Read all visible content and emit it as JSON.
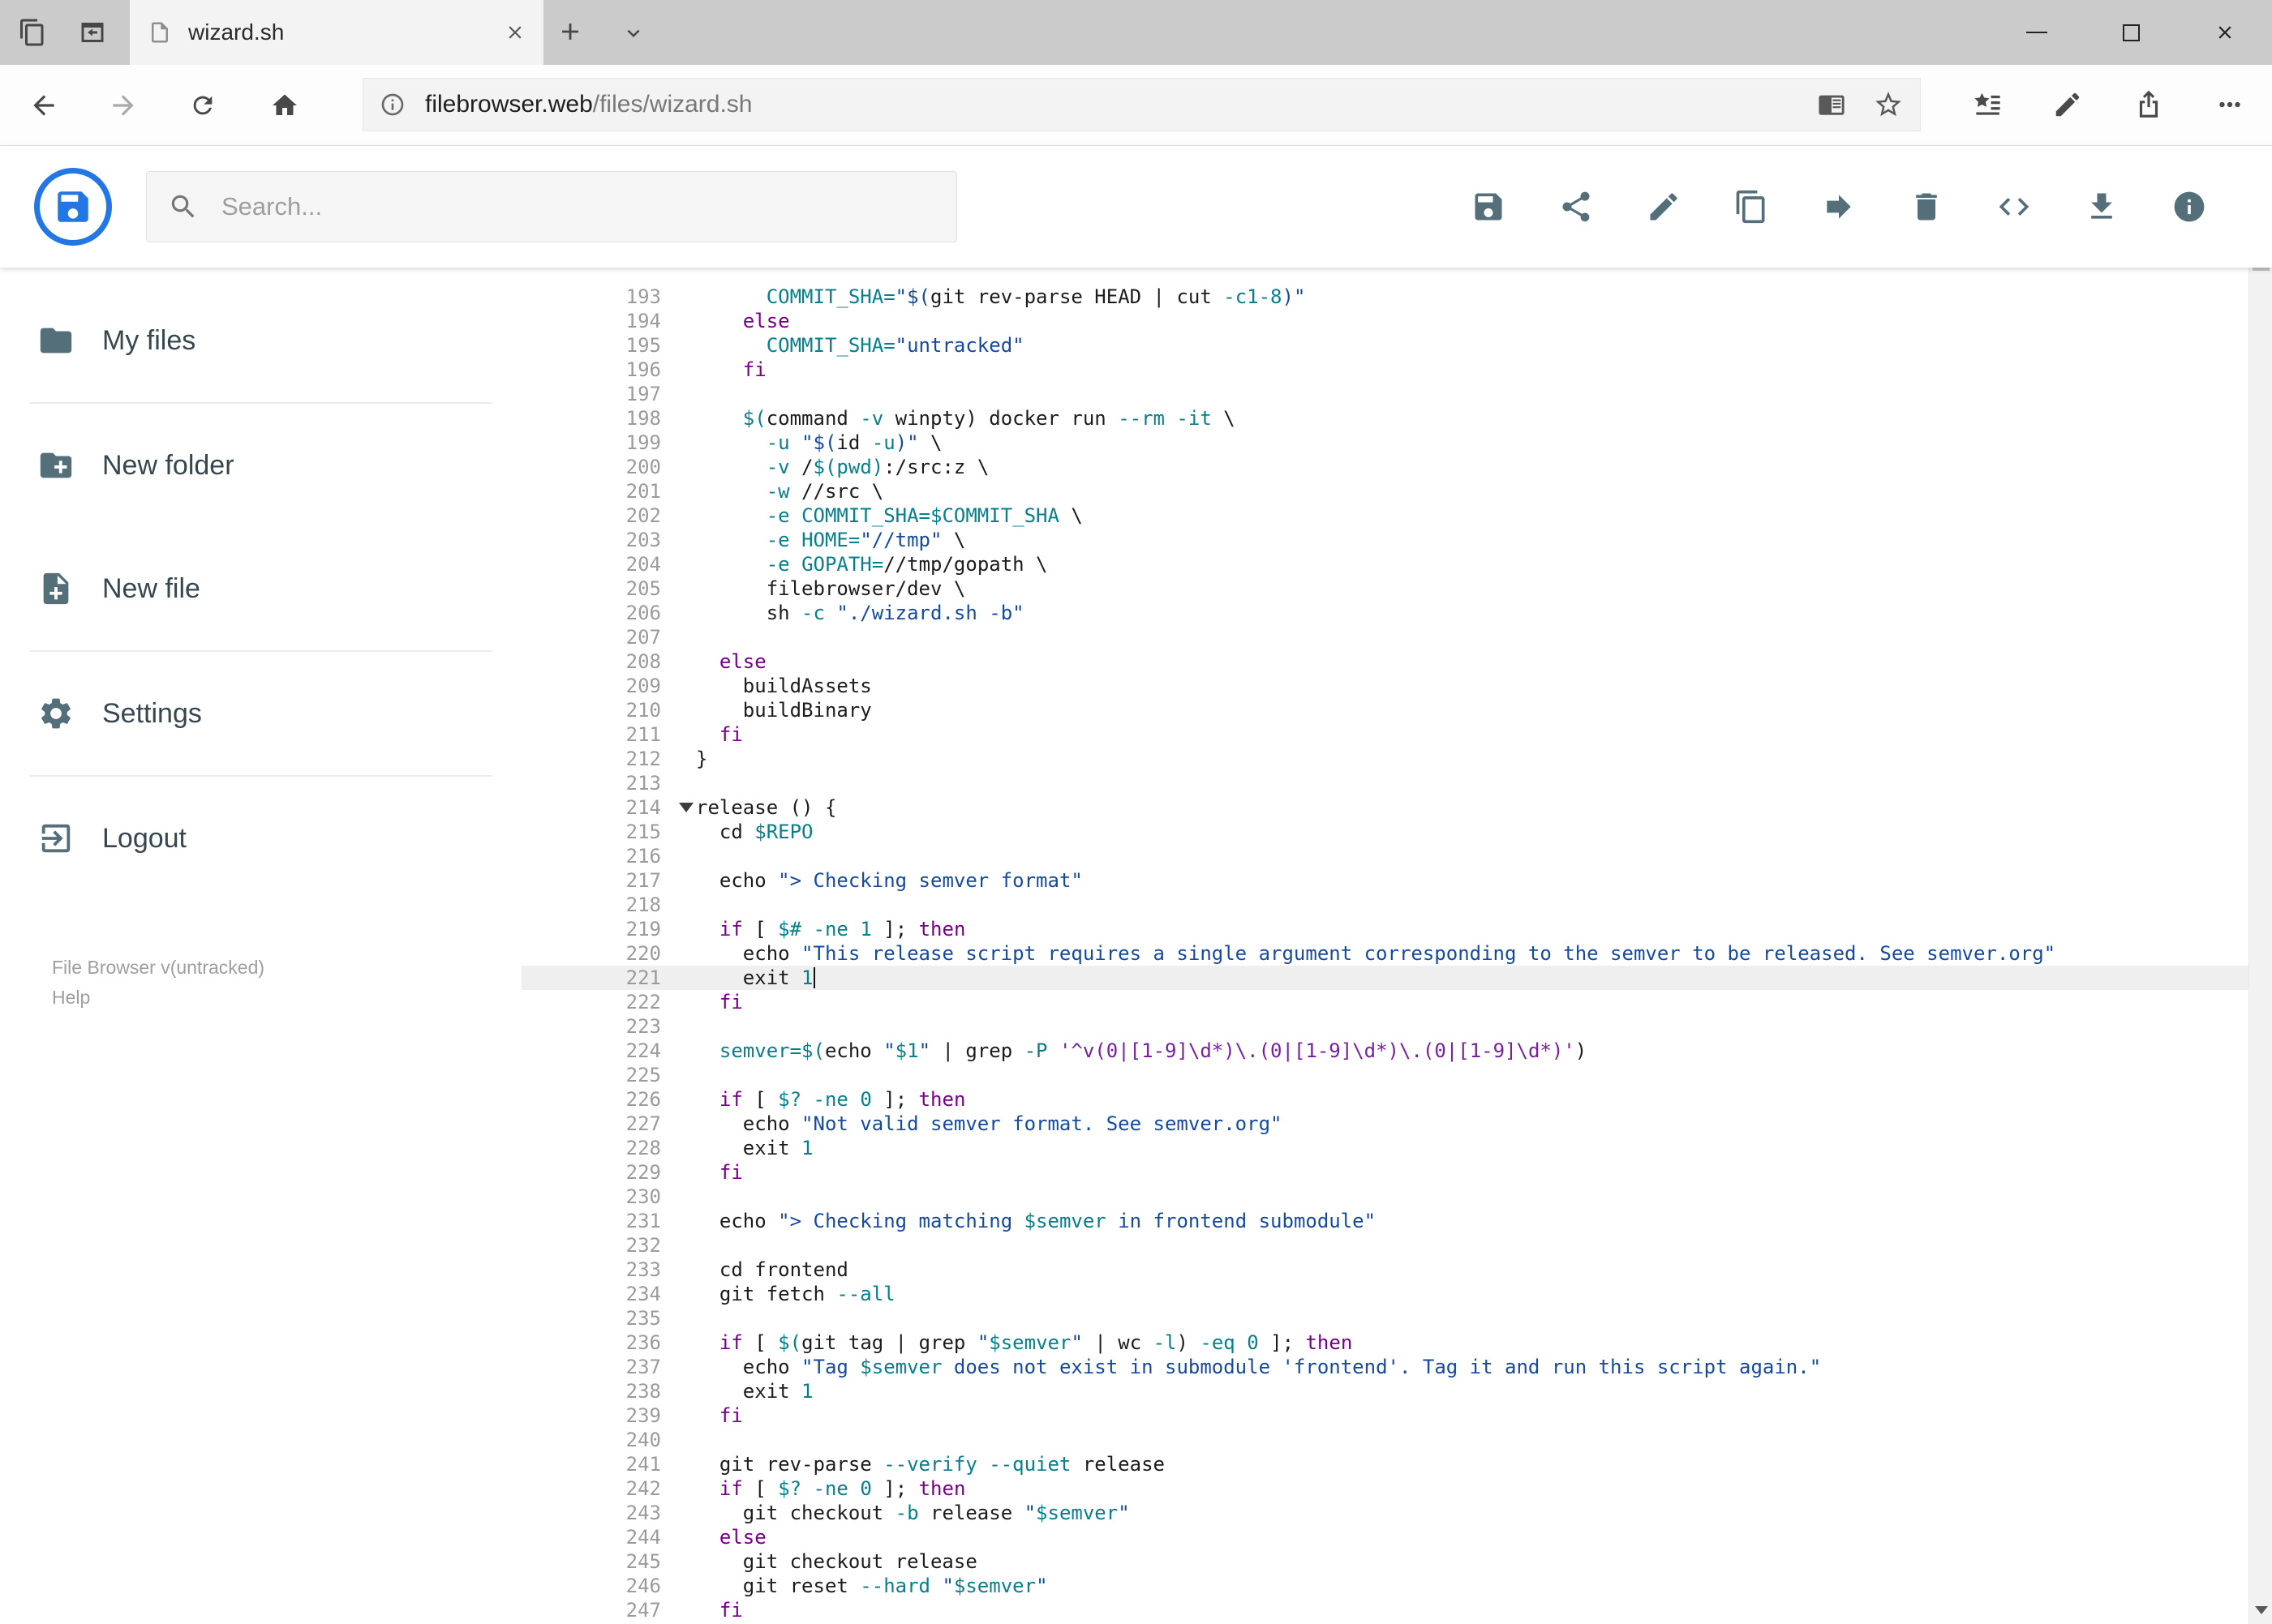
{
  "browser": {
    "tab_title": "wizard.sh",
    "url": {
      "domain": "filebrowser.web",
      "path": "/files/wizard.sh"
    },
    "tabstrip_icons": [
      "tab-preview",
      "set-tabs-aside",
      "page",
      "tab-close",
      "new-tab",
      "tab-list-chevron"
    ],
    "nav_icons": [
      "back",
      "forward",
      "refresh",
      "home"
    ],
    "url_field_icons": [
      "page-info",
      "reading-view",
      "favorite-star"
    ],
    "action_icons": [
      "favorites-hub",
      "web-note-pen",
      "share",
      "more"
    ],
    "window_controls": [
      "minimize",
      "maximize",
      "close"
    ]
  },
  "header": {
    "search_placeholder": "Search...",
    "toolbar": [
      {
        "name": "save",
        "icon": "save"
      },
      {
        "name": "share",
        "icon": "share"
      },
      {
        "name": "rename",
        "icon": "pencil"
      },
      {
        "name": "copy",
        "icon": "copy"
      },
      {
        "name": "move",
        "icon": "move"
      },
      {
        "name": "delete",
        "icon": "trash"
      },
      {
        "name": "source-code",
        "icon": "code"
      },
      {
        "name": "download",
        "icon": "download"
      },
      {
        "name": "info",
        "icon": "info"
      }
    ]
  },
  "sidebar": {
    "items": [
      {
        "label": "My files",
        "icon": "folder",
        "divider_after": true
      },
      {
        "label": "New folder",
        "icon": "new-folder",
        "divider_after": false
      },
      {
        "label": "New file",
        "icon": "new-file",
        "divider_after": true
      },
      {
        "label": "Settings",
        "icon": "settings",
        "divider_after": true
      },
      {
        "label": "Logout",
        "icon": "logout",
        "divider_after": false
      }
    ],
    "footer": {
      "version": "File Browser v(untracked)",
      "help": "Help"
    }
  },
  "editor": {
    "active_line": 221,
    "folded_line": 214,
    "lines": [
      {
        "n": 193,
        "s": [
          [
            "pl",
            "      "
          ],
          [
            "var",
            "COMMIT_SHA="
          ],
          [
            "st",
            "\"$("
          ],
          [
            "pl",
            "git rev-parse HEAD | cut "
          ],
          [
            "var",
            "-c1-8"
          ],
          [
            "st",
            ")\""
          ]
        ]
      },
      {
        "n": 194,
        "s": [
          [
            "pl",
            "    "
          ],
          [
            "kw",
            "else"
          ]
        ]
      },
      {
        "n": 195,
        "s": [
          [
            "pl",
            "      "
          ],
          [
            "var",
            "COMMIT_SHA="
          ],
          [
            "st",
            "\"untracked\""
          ]
        ]
      },
      {
        "n": 196,
        "s": [
          [
            "pl",
            "    "
          ],
          [
            "kw",
            "fi"
          ]
        ]
      },
      {
        "n": 197,
        "s": []
      },
      {
        "n": 198,
        "s": [
          [
            "pl",
            "    "
          ],
          [
            "var",
            "$("
          ],
          [
            "pl",
            "command "
          ],
          [
            "var",
            "-v"
          ],
          [
            "pl",
            " winpty) docker run "
          ],
          [
            "var",
            "--rm -it"
          ],
          [
            "pl",
            " \\"
          ]
        ]
      },
      {
        "n": 199,
        "s": [
          [
            "pl",
            "      "
          ],
          [
            "var",
            "-u"
          ],
          [
            "pl",
            " "
          ],
          [
            "st",
            "\"$("
          ],
          [
            "pl",
            "id "
          ],
          [
            "var",
            "-u"
          ],
          [
            "st",
            ")\""
          ],
          [
            "pl",
            " \\"
          ]
        ]
      },
      {
        "n": 200,
        "s": [
          [
            "pl",
            "      "
          ],
          [
            "var",
            "-v"
          ],
          [
            "pl",
            " /"
          ],
          [
            "var",
            "$(pwd)"
          ],
          [
            "pl",
            ":/src:z \\"
          ]
        ]
      },
      {
        "n": 201,
        "s": [
          [
            "pl",
            "      "
          ],
          [
            "var",
            "-w"
          ],
          [
            "pl",
            " //src \\"
          ]
        ]
      },
      {
        "n": 202,
        "s": [
          [
            "pl",
            "      "
          ],
          [
            "var",
            "-e"
          ],
          [
            "pl",
            " "
          ],
          [
            "var",
            "COMMIT_SHA=$COMMIT_SHA"
          ],
          [
            "pl",
            " \\"
          ]
        ]
      },
      {
        "n": 203,
        "s": [
          [
            "pl",
            "      "
          ],
          [
            "var",
            "-e"
          ],
          [
            "pl",
            " "
          ],
          [
            "var",
            "HOME="
          ],
          [
            "st",
            "\"//tmp\""
          ],
          [
            "pl",
            " \\"
          ]
        ]
      },
      {
        "n": 204,
        "s": [
          [
            "pl",
            "      "
          ],
          [
            "var",
            "-e"
          ],
          [
            "pl",
            " "
          ],
          [
            "var",
            "GOPATH="
          ],
          [
            "pl",
            "//tmp/gopath \\"
          ]
        ]
      },
      {
        "n": 205,
        "s": [
          [
            "pl",
            "      filebrowser/dev \\"
          ]
        ]
      },
      {
        "n": 206,
        "s": [
          [
            "pl",
            "      sh "
          ],
          [
            "var",
            "-c"
          ],
          [
            "pl",
            " "
          ],
          [
            "st",
            "\"./wizard.sh -b\""
          ]
        ]
      },
      {
        "n": 207,
        "s": []
      },
      {
        "n": 208,
        "s": [
          [
            "pl",
            "  "
          ],
          [
            "kw",
            "else"
          ]
        ]
      },
      {
        "n": 209,
        "s": [
          [
            "pl",
            "    buildAssets"
          ]
        ]
      },
      {
        "n": 210,
        "s": [
          [
            "pl",
            "    buildBinary"
          ]
        ]
      },
      {
        "n": 211,
        "s": [
          [
            "pl",
            "  "
          ],
          [
            "kw",
            "fi"
          ]
        ]
      },
      {
        "n": 212,
        "s": [
          [
            "pl",
            "}"
          ]
        ]
      },
      {
        "n": 213,
        "s": []
      },
      {
        "n": 214,
        "f": true,
        "s": [
          [
            "pl",
            "release () {"
          ]
        ]
      },
      {
        "n": 215,
        "s": [
          [
            "pl",
            "  cd "
          ],
          [
            "var",
            "$REPO"
          ]
        ]
      },
      {
        "n": 216,
        "s": []
      },
      {
        "n": 217,
        "s": [
          [
            "pl",
            "  echo "
          ],
          [
            "st",
            "\"> Checking semver format\""
          ]
        ]
      },
      {
        "n": 218,
        "s": []
      },
      {
        "n": 219,
        "s": [
          [
            "pl",
            "  "
          ],
          [
            "kw",
            "if"
          ],
          [
            "pl",
            " [ "
          ],
          [
            "var",
            "$#"
          ],
          [
            "pl",
            " "
          ],
          [
            "var",
            "-ne"
          ],
          [
            "pl",
            " "
          ],
          [
            "var",
            "1"
          ],
          [
            "pl",
            " ]; "
          ],
          [
            "kw",
            "then"
          ]
        ]
      },
      {
        "n": 220,
        "s": [
          [
            "pl",
            "    echo "
          ],
          [
            "st",
            "\"This release script requires a single argument corresponding to the semver to be released. See semver.org\""
          ]
        ]
      },
      {
        "n": 221,
        "a": true,
        "c": true,
        "s": [
          [
            "pl",
            "    exit "
          ],
          [
            "var",
            "1"
          ]
        ]
      },
      {
        "n": 222,
        "s": [
          [
            "pl",
            "  "
          ],
          [
            "kw",
            "fi"
          ]
        ]
      },
      {
        "n": 223,
        "s": []
      },
      {
        "n": 224,
        "s": [
          [
            "pl",
            "  "
          ],
          [
            "var",
            "semver=$("
          ],
          [
            "pl",
            "echo "
          ],
          [
            "st",
            "\""
          ],
          [
            "var",
            "$1"
          ],
          [
            "st",
            "\""
          ],
          [
            "pl",
            " | grep "
          ],
          [
            "var",
            "-P"
          ],
          [
            "pl",
            " "
          ],
          [
            "st2",
            "'^v(0|[1-9]\\d*)\\.(0|[1-9]\\d*)\\.(0|[1-9]\\d*)'"
          ],
          [
            "pl",
            ")"
          ]
        ]
      },
      {
        "n": 225,
        "s": []
      },
      {
        "n": 226,
        "s": [
          [
            "pl",
            "  "
          ],
          [
            "kw",
            "if"
          ],
          [
            "pl",
            " [ "
          ],
          [
            "var",
            "$?"
          ],
          [
            "pl",
            " "
          ],
          [
            "var",
            "-ne"
          ],
          [
            "pl",
            " "
          ],
          [
            "var",
            "0"
          ],
          [
            "pl",
            " ]; "
          ],
          [
            "kw",
            "then"
          ]
        ]
      },
      {
        "n": 227,
        "s": [
          [
            "pl",
            "    echo "
          ],
          [
            "st",
            "\"Not valid semver format. See semver.org\""
          ]
        ]
      },
      {
        "n": 228,
        "s": [
          [
            "pl",
            "    exit "
          ],
          [
            "var",
            "1"
          ]
        ]
      },
      {
        "n": 229,
        "s": [
          [
            "pl",
            "  "
          ],
          [
            "kw",
            "fi"
          ]
        ]
      },
      {
        "n": 230,
        "s": []
      },
      {
        "n": 231,
        "s": [
          [
            "pl",
            "  echo "
          ],
          [
            "st",
            "\"> Checking matching "
          ],
          [
            "var",
            "$semver"
          ],
          [
            "st",
            " in frontend submodule\""
          ]
        ]
      },
      {
        "n": 232,
        "s": []
      },
      {
        "n": 233,
        "s": [
          [
            "pl",
            "  cd frontend"
          ]
        ]
      },
      {
        "n": 234,
        "s": [
          [
            "pl",
            "  git fetch "
          ],
          [
            "var",
            "--all"
          ]
        ]
      },
      {
        "n": 235,
        "s": []
      },
      {
        "n": 236,
        "s": [
          [
            "pl",
            "  "
          ],
          [
            "kw",
            "if"
          ],
          [
            "pl",
            " [ "
          ],
          [
            "var",
            "$("
          ],
          [
            "pl",
            "git tag | grep "
          ],
          [
            "st",
            "\""
          ],
          [
            "var",
            "$semver"
          ],
          [
            "st",
            "\""
          ],
          [
            "pl",
            " | wc "
          ],
          [
            "var",
            "-l"
          ],
          [
            "pl",
            ") "
          ],
          [
            "var",
            "-eq"
          ],
          [
            "pl",
            " "
          ],
          [
            "var",
            "0"
          ],
          [
            "pl",
            " ]; "
          ],
          [
            "kw",
            "then"
          ]
        ]
      },
      {
        "n": 237,
        "s": [
          [
            "pl",
            "    echo "
          ],
          [
            "st",
            "\"Tag "
          ],
          [
            "var",
            "$semver"
          ],
          [
            "st",
            " does not exist in submodule 'frontend'. Tag it and run this script again.\""
          ]
        ]
      },
      {
        "n": 238,
        "s": [
          [
            "pl",
            "    exit "
          ],
          [
            "var",
            "1"
          ]
        ]
      },
      {
        "n": 239,
        "s": [
          [
            "pl",
            "  "
          ],
          [
            "kw",
            "fi"
          ]
        ]
      },
      {
        "n": 240,
        "s": []
      },
      {
        "n": 241,
        "s": [
          [
            "pl",
            "  git rev-parse "
          ],
          [
            "var",
            "--verify --quiet"
          ],
          [
            "pl",
            " release"
          ]
        ]
      },
      {
        "n": 242,
        "s": [
          [
            "pl",
            "  "
          ],
          [
            "kw",
            "if"
          ],
          [
            "pl",
            " [ "
          ],
          [
            "var",
            "$?"
          ],
          [
            "pl",
            " "
          ],
          [
            "var",
            "-ne"
          ],
          [
            "pl",
            " "
          ],
          [
            "var",
            "0"
          ],
          [
            "pl",
            " ]; "
          ],
          [
            "kw",
            "then"
          ]
        ]
      },
      {
        "n": 243,
        "s": [
          [
            "pl",
            "    git checkout "
          ],
          [
            "var",
            "-b"
          ],
          [
            "pl",
            " release "
          ],
          [
            "st",
            "\""
          ],
          [
            "var",
            "$semver"
          ],
          [
            "st",
            "\""
          ]
        ]
      },
      {
        "n": 244,
        "s": [
          [
            "pl",
            "  "
          ],
          [
            "kw",
            "else"
          ]
        ]
      },
      {
        "n": 245,
        "s": [
          [
            "pl",
            "    git checkout release"
          ]
        ]
      },
      {
        "n": 246,
        "s": [
          [
            "pl",
            "    git reset "
          ],
          [
            "var",
            "--hard"
          ],
          [
            "pl",
            " "
          ],
          [
            "st",
            "\""
          ],
          [
            "var",
            "$semver"
          ],
          [
            "st",
            "\""
          ]
        ]
      },
      {
        "n": 247,
        "s": [
          [
            "pl",
            "  "
          ],
          [
            "kw",
            "fi"
          ]
        ]
      }
    ]
  },
  "colors": {
    "accent": "#2377e4",
    "toolbar_icon": "#546e7a",
    "keyword": "#770088",
    "string": "#164a9e",
    "regex_string": "#7b1fa2",
    "variable": "#087f8c",
    "plain": "#1c1c1c",
    "line_number": "#9b9b9b",
    "active_line_bg": "#efefef"
  }
}
